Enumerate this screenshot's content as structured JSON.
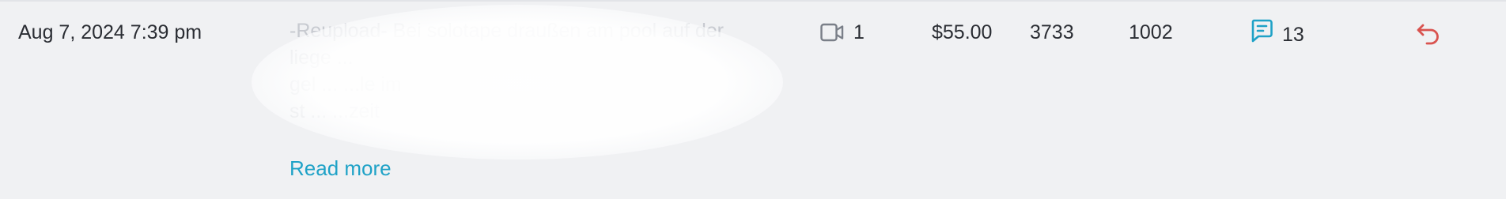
{
  "row": {
    "date": "Aug 7, 2024 7:39 pm",
    "description_lines": [
      "-Reupload- Bei solotape draußen am pool auf der",
      "liege ...",
      "gel ...                                            ...le im",
      "st ...                                            ...zeit"
    ],
    "read_more_label": "Read more",
    "video_count": "1",
    "price": "$55.00",
    "value_a": "3733",
    "value_b": "1002",
    "message_count": "13",
    "icons": {
      "video": "video-camera-icon",
      "message": "chat-message-icon",
      "undo": "undo-arrow-icon"
    },
    "colors": {
      "accent": "#1fa2c7",
      "undo": "#d9534f",
      "icon_gray": "#7a7f88"
    }
  }
}
